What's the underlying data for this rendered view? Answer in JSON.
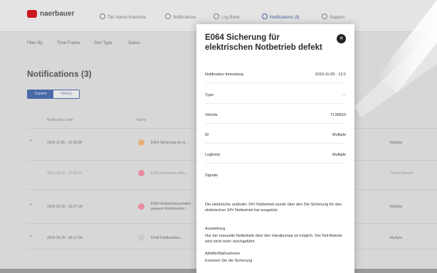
{
  "app": {
    "logo_text": "naerbauer",
    "nav": [
      "Tier Name Koenicke",
      "Notifications",
      "Log Book",
      "Notifications (3)",
      "Support"
    ],
    "subnav": [
      "Filter By",
      "Time Frame",
      "Sort Type",
      "Status"
    ]
  },
  "page": {
    "title": "Notifications (3)",
    "toggle": [
      "Current",
      "History"
    ]
  },
  "table": {
    "headers": [
      "Notification Date",
      "Name"
    ],
    "rows": [
      {
        "expand": "+",
        "date": "2019-11-05 · 12:32:08",
        "name": "E064 Sicherung für el...",
        "status": "Multiple",
        "dot": "#e8b07a",
        "light": false
      },
      {
        "expand": "",
        "date": "2019-10-25 · 12:32:11",
        "name": "E060 Notbetrieb aktiv...",
        "status": "Ticket Opened",
        "dot": "#e88aa0",
        "light": true
      },
      {
        "expand": "+",
        "date": "2019-10-25 · 12:27:18",
        "name": "E059 Notbetriebsschalter · gesperrt Kombination...",
        "status": "Multiple",
        "dot": "#e88aa0",
        "light": false
      },
      {
        "expand": "+",
        "date": "2019-10-25 · 06:17:34",
        "name": "E108 Fehlfunktion...",
        "status": "Multiple",
        "dot": "#c9c9c9",
        "light": false
      }
    ]
  },
  "modal": {
    "title": "E064 Sicherung für elektrischen Notbetrieb defekt",
    "fields": [
      {
        "label": "Notification timestamp",
        "value": "2019-11-05 · 12:2"
      },
      {
        "label": "Type",
        "value": "···"
      },
      {
        "label": "Vehicle",
        "value": "TL90810"
      },
      {
        "label": "ID",
        "value": "Multiple"
      },
      {
        "label": "Logbook",
        "value": "Multiple"
      },
      {
        "label": "Signals",
        "value": ""
      }
    ],
    "description": "Die elektrische und/oder 24V Notbetrieb wurde über den Die Sicherung für den elektrischen 24V Notbetrieb hat ausgelöst",
    "section1_head": "Auswirkung",
    "section1_text": "Nur der manuelle Notbetrieb über den Handpumpe ist möglich. Der Not-Betrieb wird nicht mehr durchgeführt",
    "section2_head": "Abhilfe/Maßnahmen",
    "section2_text": "Ersetzen Sie die Sicherung"
  },
  "colors": {
    "brand": "#c8171e",
    "accent": "#4a6aa8"
  }
}
